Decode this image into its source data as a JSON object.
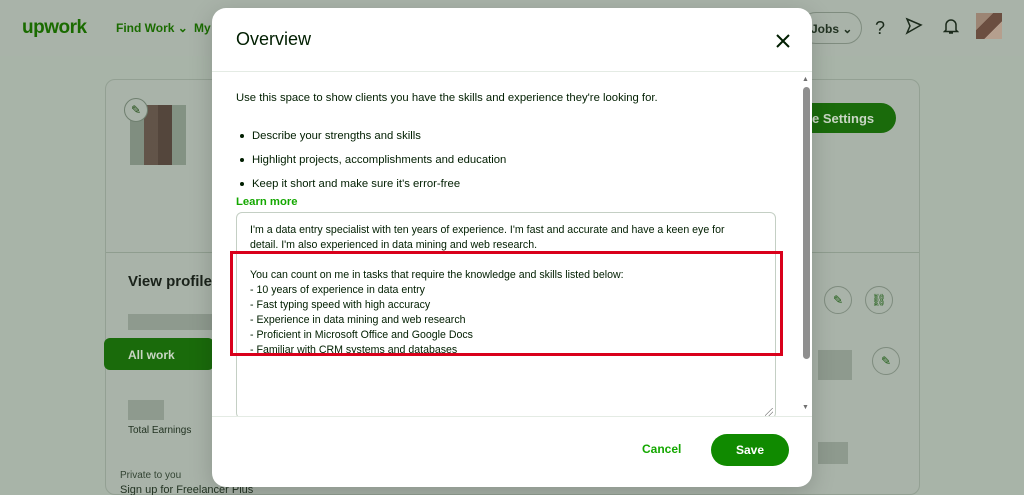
{
  "app": {
    "logo": "upwork",
    "nav": {
      "find_work": "Find Work ⌄",
      "my": "My",
      "jobs": "Jobs ⌄"
    },
    "icons": {
      "help": "question-icon",
      "send": "paper-plane-icon",
      "notifications": "bell-icon"
    }
  },
  "background_profile": {
    "settings_button": "e Settings",
    "view_profile": "View profile",
    "all_work": "All work",
    "total_earnings": "Total Earnings",
    "private": "Private to you",
    "signup": "Sign up for Freelancer Plus"
  },
  "modal": {
    "title": "Overview",
    "intro": "Use this space to show clients you have the skills and experience they're looking for.",
    "bullets": [
      "Describe your strengths and skills",
      "Highlight projects, accomplishments and education",
      "Keep it short and make sure it's error-free"
    ],
    "learn_more": "Learn more",
    "textarea": {
      "para1": "I'm a data entry specialist with ten years of experience. I'm fast and accurate and have a keen eye for\ndetail. I'm also experienced in data mining and web research.",
      "para2": "You can count on me in tasks that require the knowledge and skills listed below:\n- 10 years of experience in data entry\n- Fast typing speed with high accuracy\n- Experience in data mining and web research\n- Proficient in Microsoft Office and Google Docs\n- Familiar with CRM systems and databases"
    },
    "cancel": "Cancel",
    "save": "Save"
  },
  "colors": {
    "brand_green": "#108a00",
    "link_green": "#14a800",
    "highlight_red": "#d9001b",
    "overlay": "#a8b4a8"
  }
}
